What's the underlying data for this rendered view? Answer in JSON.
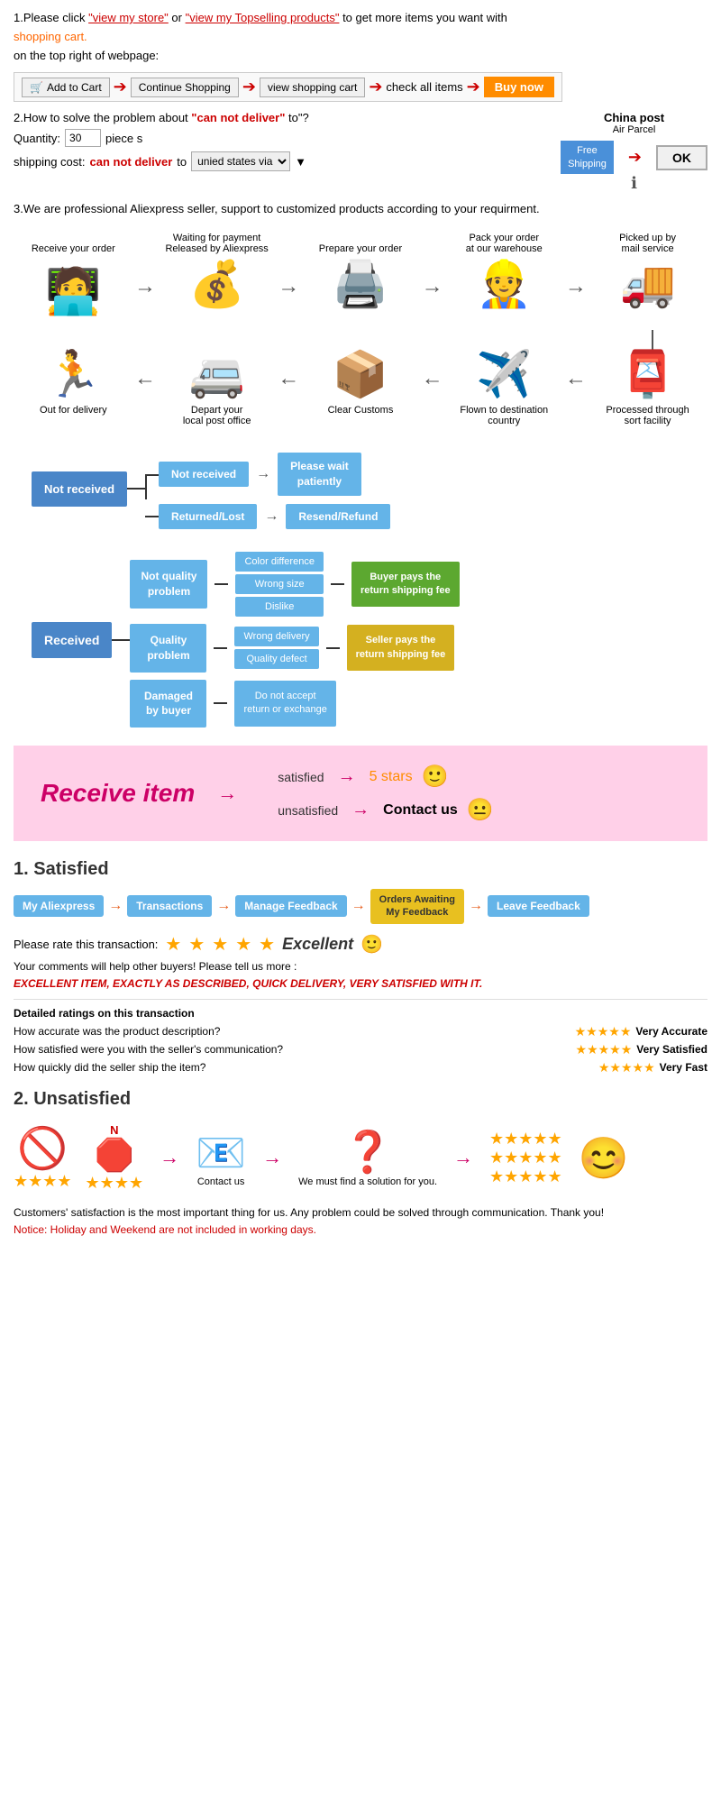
{
  "section1": {
    "text1": "1.Please click ",
    "link1": "\"view my store\"",
    "text2": "or ",
    "link2": "\"view my Topselling products\"",
    "text3": " to get more items you want with",
    "text4": "shopping cart.",
    "text5": "on the top right of webpage:",
    "cart_btn": "Add to Cart",
    "continue_btn": "Continue Shopping",
    "view_cart_btn": "view shopping cart",
    "check_all_btn": "check all items",
    "buy_now_btn": "Buy now"
  },
  "section2": {
    "title": "2.How to solve the problem about",
    "cannot_deliver": "\"can not deliver\"",
    "title_end": " to\"?",
    "quantity_label": "Quantity:",
    "quantity_value": "30",
    "piece_label": "piece s",
    "shipping_label": "shipping cost:",
    "cannot_text": "can not deliver",
    "to_text": " to ",
    "shipping_via": "unied states via",
    "china_post_title": "China post",
    "china_post_sub": "Air Parcel",
    "free_shipping": "Free\nShipping",
    "ok_btn": "OK"
  },
  "section3": {
    "text": "3.We are professional Aliexpress seller, support to customized products according to your requirment."
  },
  "process_steps_top": [
    {
      "label": "Receive your order",
      "icon": "🧑‍💻"
    },
    {
      "label": "Waiting for payment\nReleased by Aliexpress",
      "icon": "💰"
    },
    {
      "label": "Prepare your order",
      "icon": "🖨️"
    },
    {
      "label": "Pack your order\nat our warehouse",
      "icon": "👷"
    },
    {
      "label": "Picked up by\nmail service",
      "icon": "🚚"
    }
  ],
  "process_steps_bottom": [
    {
      "label": "Out for delivery",
      "icon": "🏃"
    },
    {
      "label": "Depart your\nlocal post office",
      "icon": "🚐"
    },
    {
      "label": "Clear Customs",
      "icon": "📦"
    },
    {
      "label": "Flown to destination\ncountry",
      "icon": "✈️"
    },
    {
      "label": "Processed through\nsort facility",
      "icon": "📮"
    }
  ],
  "not_received": {
    "main_label": "Not received",
    "branch1": "Not received",
    "result1": "Please wait\npatiently",
    "branch2": "Returned/Lost",
    "result2": "Resend/Refund"
  },
  "received": {
    "main_label": "Received",
    "branch1_label": "Not quality\nproblem",
    "branch1_subs": [
      "Color difference",
      "Wrong size",
      "Dislike"
    ],
    "branch1_outcome": "Buyer pays the\nreturn shipping fee",
    "branch2_label": "Quality\nproblem",
    "branch2_subs": [
      "Wrong delivery",
      "Quality defect"
    ],
    "branch2_outcome": "Seller pays the\nreturn shipping fee",
    "branch3_label": "Damaged\nby buyer",
    "branch3_outcome": "Do not accept\nreturn or exchange"
  },
  "receive_item": {
    "title": "Receive item",
    "satisfied": "satisfied",
    "unsatisfied": "unsatisfied",
    "result1": "5 stars",
    "result2": "Contact us"
  },
  "satisfied": {
    "section_num": "1. Satisfied",
    "steps": [
      "My Aliexpress",
      "Transactions",
      "Manage Feedback",
      "Orders Awaiting\nMy Feedback",
      "Leave Feedback"
    ],
    "rate_label": "Please rate this transaction:",
    "excellent": "Excellent",
    "comment": "Your comments will help other buyers! Please tell us more :",
    "review": "EXCELLENT ITEM, EXACTLY AS DESCRIBED, QUICK DELIVERY, VERY SATISFIED WITH IT.",
    "detailed_title": "Detailed ratings on this transaction",
    "dr1_q": "How accurate was the product description?",
    "dr1_a": "Very Accurate",
    "dr2_q": "How satisfied were you with the seller's communication?",
    "dr2_a": "Very Satisfied",
    "dr3_q": "How quickly did the seller ship the item?",
    "dr3_a": "Very Fast"
  },
  "unsatisfied": {
    "section_num": "2. Unsatisfied",
    "contact_label": "Contact us",
    "solution_label": "We must find\na solution for\nyou.",
    "footer": "Customers' satisfaction is the most important thing for us. Any problem could be solved through\ncommunication. Thank you!",
    "notice": "Notice: Holiday and Weekend are not included in working days."
  }
}
